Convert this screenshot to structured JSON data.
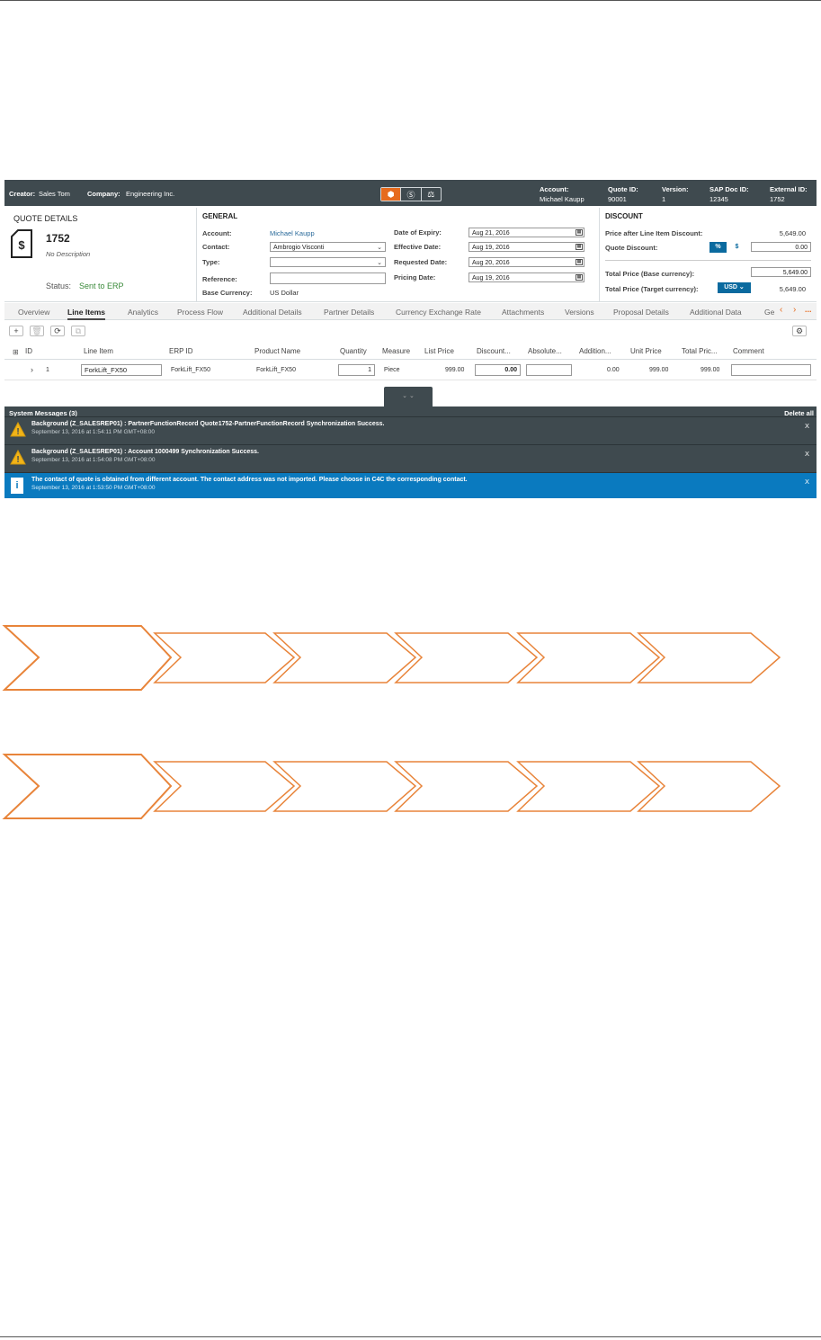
{
  "topbar": {
    "creator_label": "Creator:",
    "creator_value": "Sales Tom",
    "company_label": "Company:",
    "company_value": "Engineering Inc.",
    "mode_icons": [
      "box-icon",
      "dollar-icon",
      "scales-icon"
    ],
    "account_label": "Account:",
    "account_value": "Michael Kaupp",
    "quote_id_label": "Quote ID:",
    "quote_id_value": "90001",
    "version_label": "Version:",
    "version_value": "1",
    "sap_doc_label": "SAP Doc ID:",
    "sap_doc_value": "12345",
    "external_label": "External ID:",
    "external_value": "1752"
  },
  "quote": {
    "section_title": "QUOTE DETAILS",
    "number": "1752",
    "description": "No Description",
    "status_label": "Status:",
    "status_value": "Sent to ERP"
  },
  "general": {
    "title": "GENERAL",
    "account_label": "Account:",
    "account_value": "Michael Kaupp",
    "contact_label": "Contact:",
    "contact_value": "Ambrogio Visconti",
    "type_label": "Type:",
    "type_value": "",
    "reference_label": "Reference:",
    "reference_value": "",
    "currency_label": "Base Currency:",
    "currency_value": "US Dollar",
    "expiry_label": "Date of Expiry:",
    "expiry_value": "Aug 21, 2016",
    "effective_label": "Effective Date:",
    "effective_value": "Aug 19, 2016",
    "requested_label": "Requested Date:",
    "requested_value": "Aug 20, 2016",
    "pricing_label": "Pricing Date:",
    "pricing_value": "Aug 19, 2016"
  },
  "discount": {
    "title": "DISCOUNT",
    "after_label": "Price after Line Item Discount:",
    "after_value": "5,649.00",
    "quote_label": "Quote Discount:",
    "pct_btn": "%",
    "dollar_btn": "$",
    "quote_value": "0.00",
    "base_label": "Total Price (Base currency):",
    "base_value": "5,649.00",
    "target_label": "Total Price (Target currency):",
    "target_currency": "USD",
    "target_value": "5,649.00"
  },
  "tabs": [
    "Overview",
    "Line Items",
    "Analytics",
    "Process Flow",
    "Additional Details",
    "Partner Details",
    "Currency Exchange Rate",
    "Attachments",
    "Versions",
    "Proposal Details",
    "Additional Data",
    "Ge"
  ],
  "tabs_more": "...",
  "grid": {
    "toolbar": {
      "add": "+",
      "delete": "🗑",
      "refresh": "⟳",
      "copy": "⧉",
      "settings": "⚙"
    },
    "headers": [
      "ID",
      "Line Item",
      "ERP ID",
      "Product Name",
      "Quantity",
      "Measure",
      "List Price",
      "Discount...",
      "Absolute...",
      "Addition...",
      "Unit Price",
      "Total Pric...",
      "Comment"
    ],
    "row": {
      "id": "1",
      "line_item": "ForkLift_FX50",
      "erp_id": "ForkLift_FX50",
      "product": "ForkLift_FX50",
      "quantity": "1",
      "measure": "Piece",
      "list_price": "999.00",
      "discount": "0.00",
      "absolute": "",
      "additional": "0.00",
      "unit_price": "999.00",
      "total_price": "999.00",
      "comment": ""
    }
  },
  "system_messages": {
    "title": "System Messages (3)",
    "delete_all": "Delete all",
    "close": "X",
    "items": [
      {
        "type": "warning",
        "text": "Background (Z_SALESREP01) : PartnerFunctionRecord Quote1752-PartnerFunctionRecord Synchronization Success.",
        "time": "September 13, 2016 at 1:54:11 PM GMT+08:00"
      },
      {
        "type": "warning",
        "text": "Background (Z_SALESREP01) : Account 1000499 Synchronization Success.",
        "time": "September 13, 2016 at 1:54:08 PM GMT+08:00"
      },
      {
        "type": "info",
        "text": "The contact of quote is obtained from different account. The contact address was not imported. Please choose in C4C the corresponding contact.",
        "time": "September 13, 2016 at 1:53:50 PM GMT+08:00"
      }
    ]
  },
  "colors": {
    "accent": "#e66b1e",
    "header_bg": "#3f4a4f",
    "info_bg": "#0a7abf",
    "link": "#2a6a9a",
    "status": "#3a8a3a"
  }
}
